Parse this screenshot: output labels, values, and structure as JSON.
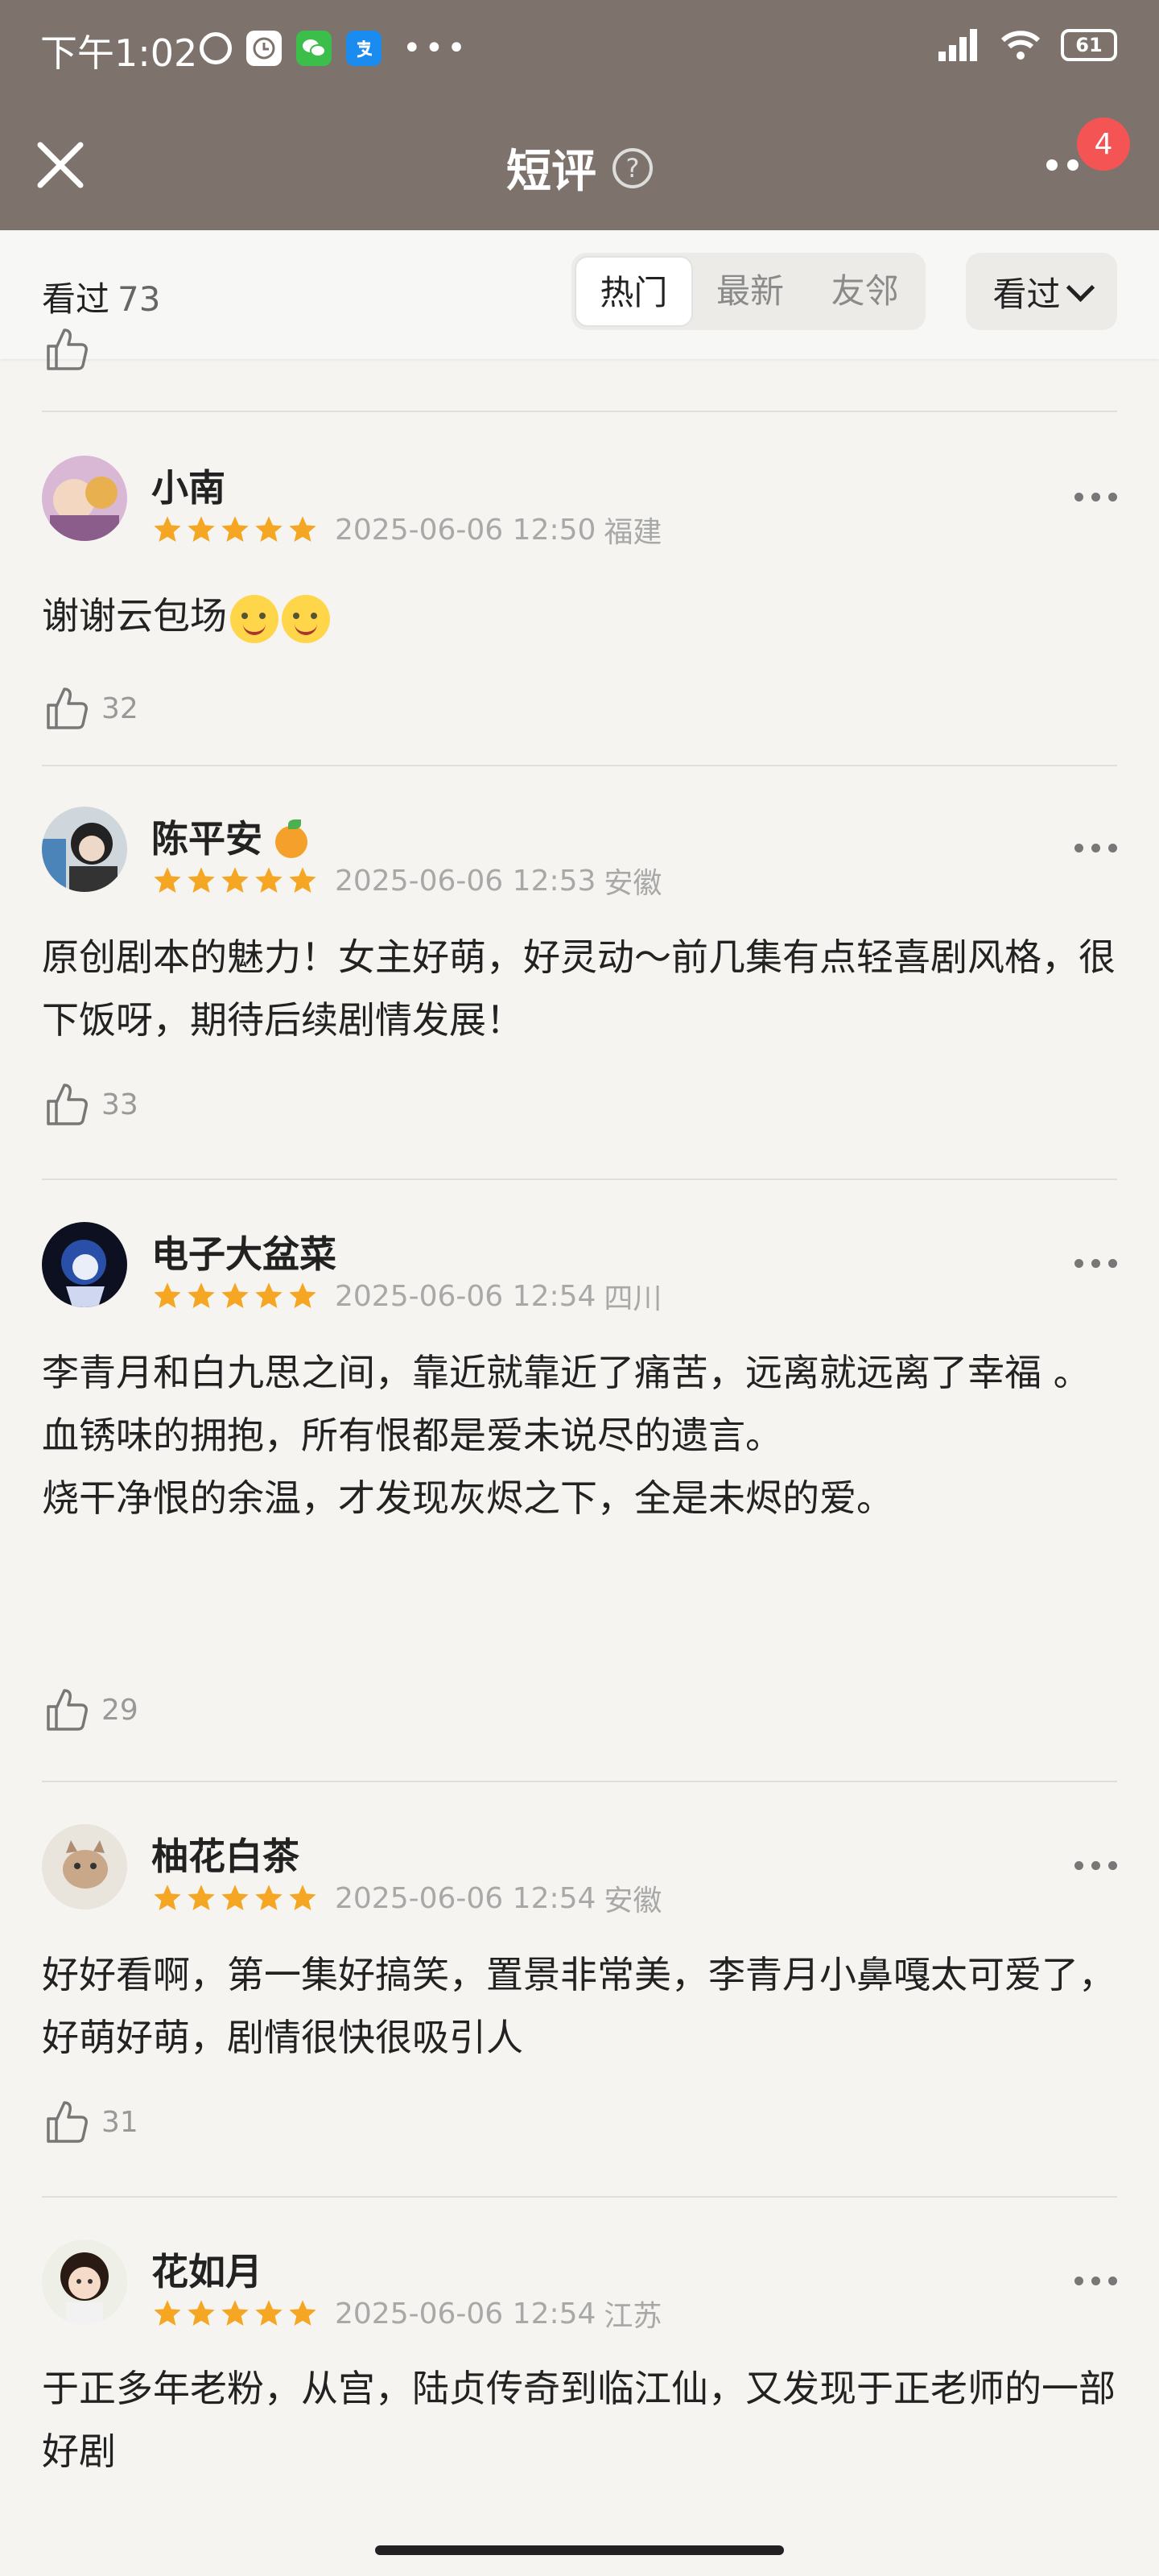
{
  "status_bar": {
    "time": "下午1:02",
    "battery": "61",
    "icons": [
      "timer-icon",
      "clock-app-icon",
      "wechat-icon",
      "alipay-icon",
      "more-dots-icon",
      "signal-icon",
      "wifi-icon",
      "battery-icon"
    ]
  },
  "nav": {
    "title": "短评",
    "badge": "4",
    "icons": [
      "close-icon",
      "help-icon",
      "more-icon"
    ]
  },
  "filter": {
    "seen_label": "看过",
    "seen_count": "73",
    "tabs": [
      "热门",
      "最新",
      "友邻"
    ],
    "active_tab": "热门",
    "dropdown_label": "看过"
  },
  "reviews": [
    {
      "username": "小南",
      "rating": 5,
      "datetime": "2025-06-06 12:50",
      "location": "福建",
      "text": "谢谢云包场",
      "emoji_count": 2,
      "likes": "32"
    },
    {
      "username": "陈平安",
      "rating": 5,
      "datetime": "2025-06-06 12:53",
      "location": "安徽",
      "text": "原创剧本的魅力！女主好萌，好灵动～前几集有点轻喜剧风格，很下饭呀，期待后续剧情发展！",
      "likes": "33"
    },
    {
      "username": "电子大盆菜",
      "rating": 5,
      "datetime": "2025-06-06 12:54",
      "location": "四川",
      "text_lines": [
        "李青月和白九思之间，靠近就靠近了痛苦，远离就远离了幸福 。",
        "血锈味的拥抱，所有恨都是爱未说尽的遗言。",
        "烧干净恨的余温，才发现灰烬之下，全是未烬的爱。"
      ],
      "likes": "29"
    },
    {
      "username": "柚花白茶",
      "rating": 5,
      "datetime": "2025-06-06 12:54",
      "location": "安徽",
      "text": "好好看啊，第一集好搞笑，置景非常美，李青月小鼻嘎太可爱了，好萌好萌，剧情很快很吸引人",
      "likes": "31"
    },
    {
      "username": "花如月",
      "rating": 5,
      "datetime": "2025-06-06 12:54",
      "location": "江苏",
      "text": "于正多年老粉，从宫，陆贞传奇到临江仙，又发现于正老师的一部好剧"
    }
  ]
}
